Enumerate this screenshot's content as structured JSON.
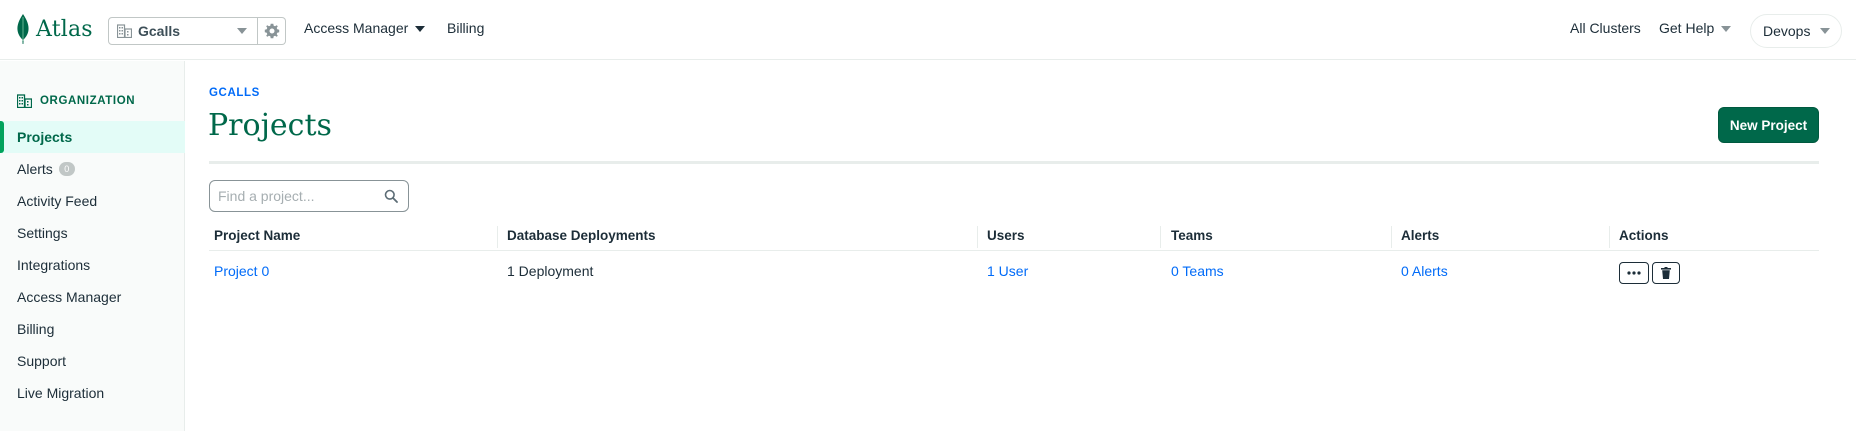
{
  "topbar": {
    "app_name": "Atlas",
    "org_name": "Gcalls",
    "nav": {
      "access_manager": "Access Manager",
      "billing": "Billing",
      "all_clusters": "All Clusters",
      "get_help": "Get Help",
      "user_menu": "Devops"
    }
  },
  "sidebar": {
    "header": "ORGANIZATION",
    "items": [
      {
        "label": "Projects",
        "active": true
      },
      {
        "label": "Alerts",
        "badge": "0"
      },
      {
        "label": "Activity Feed"
      },
      {
        "label": "Settings"
      },
      {
        "label": "Integrations"
      },
      {
        "label": "Access Manager"
      },
      {
        "label": "Billing"
      },
      {
        "label": "Support"
      },
      {
        "label": "Live Migration"
      }
    ]
  },
  "main": {
    "breadcrumb": "GCALLS",
    "title": "Projects",
    "new_project_label": "New Project",
    "search_placeholder": "Find a project...",
    "table": {
      "columns": [
        "Project Name",
        "Database Deployments",
        "Users",
        "Teams",
        "Alerts",
        "Actions"
      ],
      "rows": [
        {
          "name": "Project 0",
          "deployments": "1 Deployment",
          "users": "1 User",
          "teams": "0 Teams",
          "alerts": "0 Alerts"
        }
      ]
    }
  },
  "colors": {
    "brand_green": "#00684a",
    "link_blue": "#016bf8",
    "active_bg": "#e3fcf7"
  }
}
